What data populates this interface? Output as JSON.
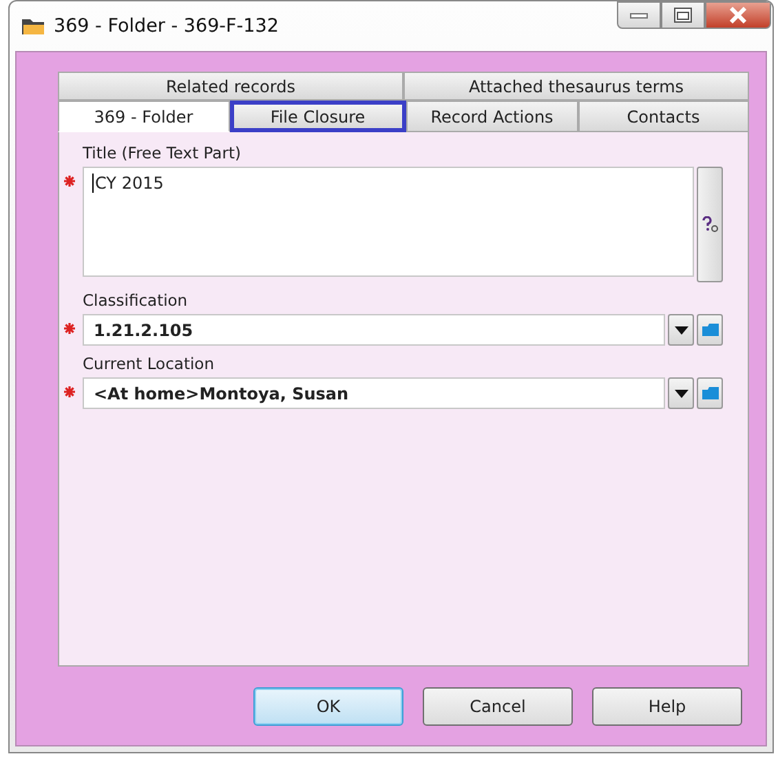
{
  "window": {
    "title": "369 - Folder - 369-F-132"
  },
  "tab_rows": [
    [
      {
        "label": "Related records",
        "selected": false,
        "focused": false
      },
      {
        "label": "Attached thesaurus terms",
        "selected": false,
        "focused": false
      }
    ],
    [
      {
        "label": "369 - Folder",
        "selected": true,
        "focused": false
      },
      {
        "label": "File Closure",
        "selected": false,
        "focused": true
      },
      {
        "label": "Record Actions",
        "selected": false,
        "focused": false
      },
      {
        "label": "Contacts",
        "selected": false,
        "focused": false
      }
    ]
  ],
  "fields": [
    {
      "kind": "textarea",
      "label": "Title (Free Text Part)",
      "value": "CY 2015",
      "required": true
    },
    {
      "kind": "combo",
      "label": "Classification",
      "value": "1.21.2.105",
      "required": true
    },
    {
      "kind": "combo",
      "label": "Current Location",
      "value": "<At home>Montoya, Susan",
      "required": true
    }
  ],
  "buttons": [
    {
      "label": "OK",
      "default": true
    },
    {
      "label": "Cancel",
      "default": false
    },
    {
      "label": "Help",
      "default": false
    }
  ]
}
